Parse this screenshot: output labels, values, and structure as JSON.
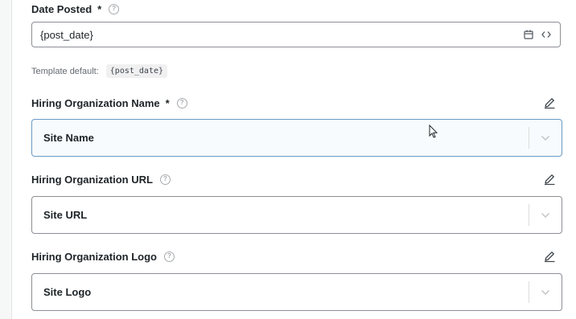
{
  "fields": {
    "date_posted": {
      "label": "Date Posted",
      "required_mark": "*",
      "value": "{post_date}",
      "template_default_label": "Template default:",
      "template_default_value": "{post_date}"
    },
    "hiring_org_name": {
      "label": "Hiring Organization Name",
      "required_mark": "*",
      "selected": "Site Name"
    },
    "hiring_org_url": {
      "label": "Hiring Organization URL",
      "selected": "Site URL"
    },
    "hiring_org_logo": {
      "label": "Hiring Organization Logo",
      "selected": "Site Logo"
    }
  },
  "icons": {
    "help": "question-circle-icon",
    "calendar": "calendar-icon",
    "code": "code-icon",
    "edit": "pencil-icon",
    "dropdown": "chevron-down-icon",
    "cursor": "mouse-cursor-icon"
  },
  "colors": {
    "text": "#1d2327",
    "muted": "#646970",
    "border": "#8c8f94",
    "focus_border": "#6b9ac4",
    "icon": "#50575e"
  }
}
